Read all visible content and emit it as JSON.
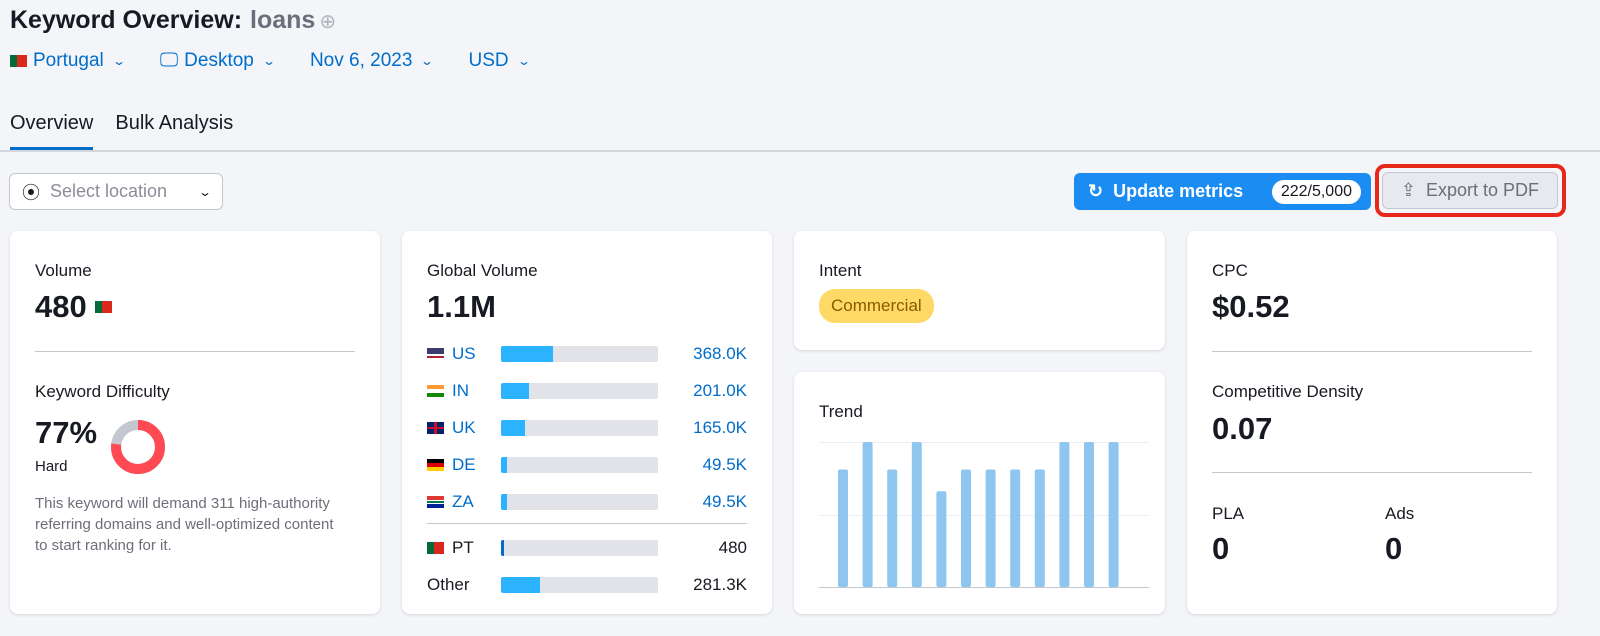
{
  "header": {
    "title": "Keyword Overview:",
    "keyword": "loans",
    "add_icon": "plus-circle-icon"
  },
  "filters": {
    "country": "Portugal",
    "device": "Desktop",
    "date": "Nov 6, 2023",
    "currency": "USD"
  },
  "tabs": [
    {
      "label": "Overview",
      "active": true
    },
    {
      "label": "Bulk Analysis",
      "active": false
    }
  ],
  "toolbar": {
    "location_placeholder": "Select location",
    "update_label": "Update metrics",
    "update_count": "222/5,000",
    "export_label": "Export to PDF"
  },
  "volume": {
    "label": "Volume",
    "value": "480"
  },
  "difficulty": {
    "label": "Keyword Difficulty",
    "value": "77%",
    "level": "Hard",
    "percent": 77,
    "color": "#ff4953",
    "description": "This keyword will demand 311 high-authority referring domains and well-optimized content to start ranking for it."
  },
  "global": {
    "label": "Global Volume",
    "value": "1.1M",
    "rows": [
      {
        "code": "US",
        "value": "368.0K",
        "fill": 33
      },
      {
        "code": "IN",
        "value": "201.0K",
        "fill": 18
      },
      {
        "code": "UK",
        "value": "165.0K",
        "fill": 15
      },
      {
        "code": "DE",
        "value": "49.5K",
        "fill": 4
      },
      {
        "code": "ZA",
        "value": "49.5K",
        "fill": 4
      }
    ],
    "own": {
      "code": "PT",
      "value": "480",
      "fill": 2
    },
    "other": {
      "code": "Other",
      "value": "281.3K",
      "fill": 25
    }
  },
  "intent": {
    "label": "Intent",
    "value": "Commercial"
  },
  "trend": {
    "label": "Trend",
    "values": [
      0.81,
      1,
      0.81,
      1,
      0.66,
      0.81,
      0.81,
      0.81,
      0.81,
      1,
      1,
      1
    ],
    "color": "#8fc6ef"
  },
  "cpc": {
    "label": "CPC",
    "value": "$0.52"
  },
  "density": {
    "label": "Competitive Density",
    "value": "0.07"
  },
  "pla": {
    "label": "PLA",
    "value": "0"
  },
  "ads": {
    "label": "Ads",
    "value": "0"
  }
}
